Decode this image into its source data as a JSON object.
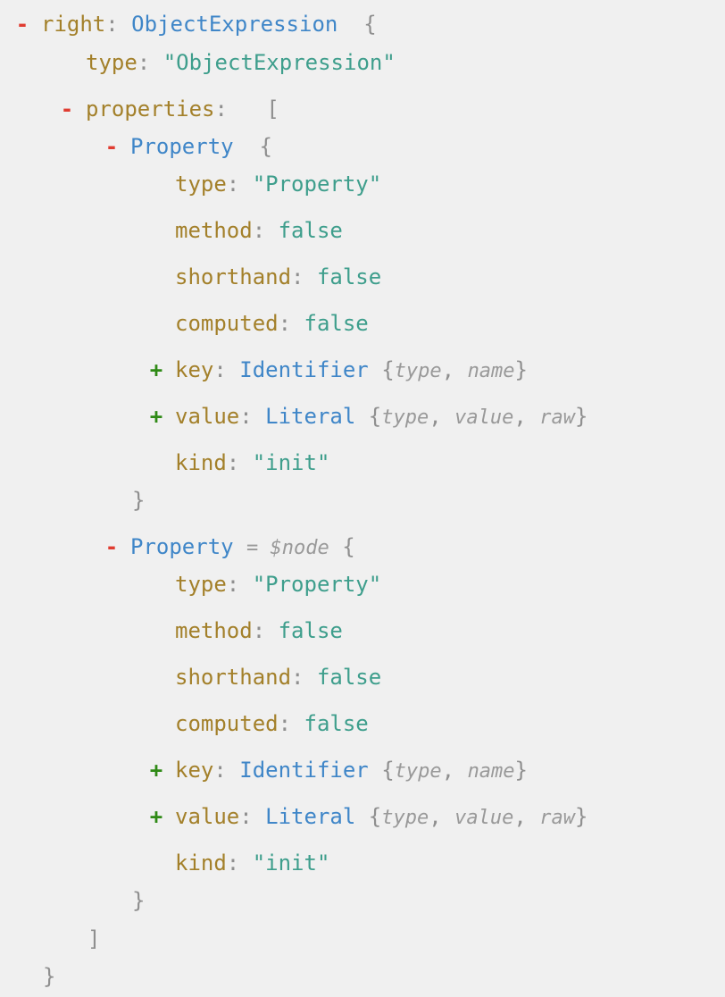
{
  "colors": {
    "background": "#f0f0f0",
    "key": "#a3802a",
    "node_type": "#3f86c8",
    "string_value": "#3e9e8c",
    "punctuation": "#8f8f8f",
    "collapse_toggle": "#e03c31",
    "expand_toggle": "#2f8a16",
    "annotation": "#999999"
  },
  "icons": {
    "collapse": "minus-icon",
    "expand": "plus-icon"
  },
  "lines": [
    {
      "depth": 0,
      "toggle": "-",
      "key": "right",
      "ntype": "ObjectExpression",
      "open": "{"
    },
    {
      "depth": 1,
      "key": "type",
      "str": "\"ObjectExpression\""
    },
    {
      "depth": 1,
      "toggle": "-",
      "key": "properties",
      "open": "["
    },
    {
      "depth": 2,
      "toggle": "-",
      "ntype": "Property",
      "open": "{"
    },
    {
      "depth": 3,
      "key": "type",
      "str": "\"Property\""
    },
    {
      "depth": 3,
      "key": "method",
      "bool": "false"
    },
    {
      "depth": 3,
      "key": "shorthand",
      "bool": "false"
    },
    {
      "depth": 3,
      "key": "computed",
      "bool": "false"
    },
    {
      "depth": 3,
      "toggle": "+",
      "key": "key",
      "ntype": "Identifier",
      "summary": [
        "type",
        "name"
      ]
    },
    {
      "depth": 3,
      "toggle": "+",
      "key": "value",
      "ntype": "Literal",
      "summary": [
        "type",
        "value",
        "raw"
      ]
    },
    {
      "depth": 3,
      "key": "kind",
      "str": "\"init\""
    },
    {
      "depth": 2,
      "close": "}"
    },
    {
      "depth": 2,
      "toggle": "-",
      "ntype": "Property",
      "annotation": "= $node",
      "open": "{"
    },
    {
      "depth": 3,
      "key": "type",
      "str": "\"Property\""
    },
    {
      "depth": 3,
      "key": "method",
      "bool": "false"
    },
    {
      "depth": 3,
      "key": "shorthand",
      "bool": "false"
    },
    {
      "depth": 3,
      "key": "computed",
      "bool": "false"
    },
    {
      "depth": 3,
      "toggle": "+",
      "key": "key",
      "ntype": "Identifier",
      "summary": [
        "type",
        "name"
      ]
    },
    {
      "depth": 3,
      "toggle": "+",
      "key": "value",
      "ntype": "Literal",
      "summary": [
        "type",
        "value",
        "raw"
      ]
    },
    {
      "depth": 3,
      "key": "kind",
      "str": "\"init\""
    },
    {
      "depth": 2,
      "close": "}"
    },
    {
      "depth": 1,
      "close": "]"
    },
    {
      "depth": 0,
      "close": "}"
    }
  ]
}
